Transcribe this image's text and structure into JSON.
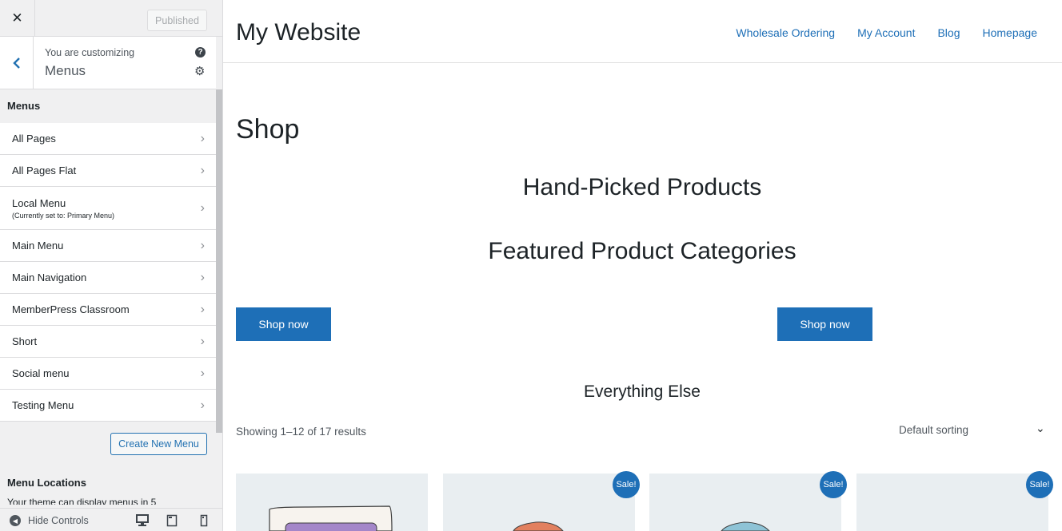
{
  "topbar": {
    "close_glyph": "✕",
    "published_label": "Published"
  },
  "customizing": {
    "label": "You are customizing",
    "title": "Menus",
    "help_glyph": "?",
    "gear_glyph": "⚙",
    "back_glyph": "‹"
  },
  "menus_section": {
    "title": "Menus",
    "items": [
      {
        "name": "All Pages",
        "sub": ""
      },
      {
        "name": "All Pages Flat",
        "sub": ""
      },
      {
        "name": "Local Menu",
        "sub": "(Currently set to: Primary Menu)"
      },
      {
        "name": "Main Menu",
        "sub": ""
      },
      {
        "name": "Main Navigation",
        "sub": ""
      },
      {
        "name": "MemberPress Classroom",
        "sub": ""
      },
      {
        "name": "Short",
        "sub": ""
      },
      {
        "name": "Social menu",
        "sub": ""
      },
      {
        "name": "Testing Menu",
        "sub": ""
      }
    ],
    "chevron_glyph": "›",
    "create_label": "Create New Menu"
  },
  "locations": {
    "title": "Menu Locations",
    "description": "Your theme can display menus in 5"
  },
  "footer": {
    "hide_label": "Hide Controls",
    "hide_glyph": "◀"
  },
  "site": {
    "title": "My Website",
    "nav": [
      "Wholesale Ordering",
      "My Account",
      "Blog",
      "Homepage"
    ]
  },
  "page": {
    "shop_title": "Shop",
    "hand_picked": "Hand-Picked Products",
    "featured": "Featured Product Categories",
    "shop_now_1": "Shop now",
    "shop_now_2": "Shop now",
    "everything_else": "Everything Else",
    "showing": "Showing 1–12 of 17 results",
    "sorting": "Default sorting",
    "sort_chevron": "⌄"
  },
  "products": {
    "sale_label": "Sale!"
  },
  "colors": {
    "accent": "#1e6fb7",
    "wp_blue": "#2271b1",
    "sidebar_bg": "#f0f0f1"
  }
}
